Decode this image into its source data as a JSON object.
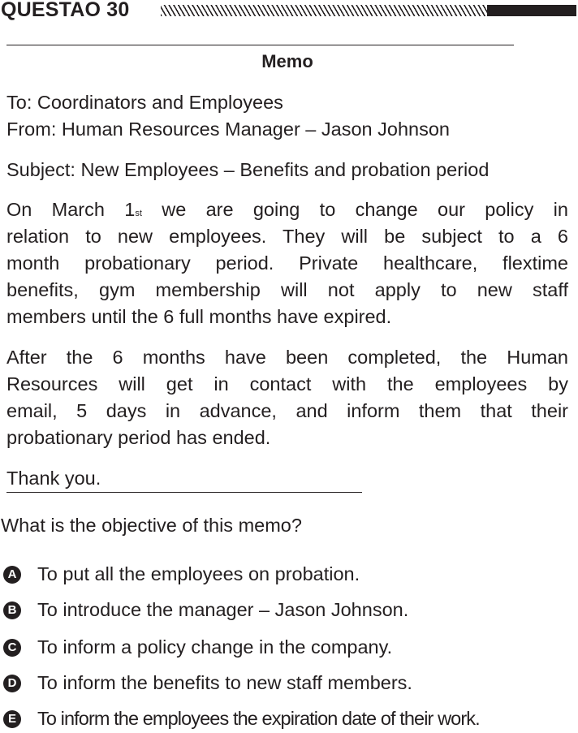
{
  "header": {
    "question_label": "QUESTAO 30"
  },
  "memo": {
    "title": "Memo",
    "to_line": "To: Coordinators and Employees",
    "from_line": "From: Human Resources Manager – Jason Johnson",
    "subject_line": "Subject: New Employees – Benefits and probation period",
    "paragraph1": {
      "line1_pre": "On March 1",
      "line1_sup": "st",
      "line1_post": " we are going to change our policy in",
      "line2": "relation to new employees. They will be subject to a 6",
      "line3": "month probationary period. Private healthcare, flextime",
      "line4": "benefits, gym membership will not apply to new staff",
      "line5": "members until the 6 full months have expired."
    },
    "paragraph2": {
      "line1": "After the 6 months have been completed, the Human",
      "line2": "Resources will get in contact with the employees by",
      "line3": "email, 5 days in advance, and inform them that their",
      "line4": "probationary period has ended."
    },
    "closing": "Thank you."
  },
  "question": "What is the objective of this memo?",
  "options": [
    {
      "letter": "A",
      "text": "To put all the employees on probation."
    },
    {
      "letter": "B",
      "text": "To introduce the manager – Jason Johnson."
    },
    {
      "letter": "C",
      "text": "To inform a policy change in the company."
    },
    {
      "letter": "D",
      "text": "To inform the benefits to new staff members."
    },
    {
      "letter": "E",
      "text": "To inform the employees the expiration date of their work."
    }
  ]
}
